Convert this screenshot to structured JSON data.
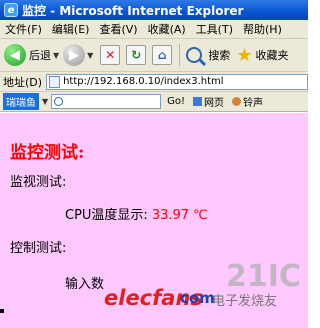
{
  "window": {
    "title": "监控 - Microsoft Internet Explorer",
    "icon": "ie-icon"
  },
  "menu": [
    "文件(F)",
    "编辑(E)",
    "查看(V)",
    "收藏(A)",
    "工具(T)",
    "帮助(H)"
  ],
  "toolbar": {
    "back_label": "后退",
    "search_label": "搜索",
    "favorites_label": "收藏夹"
  },
  "address": {
    "label": "地址(D)",
    "url": "http://192.168.0.10/index3.html"
  },
  "toolbar2": {
    "logo": "瑞瑞鱼",
    "go": "Go!",
    "item1": "网页",
    "item2": "铃声"
  },
  "content": {
    "title": "监控测试:",
    "monitor_label": "监视测试:",
    "cpu_label": "CPU温度显示:",
    "cpu_value": "33.97 ℃",
    "control_label": "控制测试:",
    "input_label": "输入数"
  },
  "watermark": {
    "brand": "elecfans",
    "suffix": "com",
    "cn": "电子发烧友",
    "big": "21IC"
  },
  "colors": {
    "page_bg": "#ffc8ff",
    "title_red": "#ff0000",
    "titlebar_blue": "#0a57d3"
  }
}
